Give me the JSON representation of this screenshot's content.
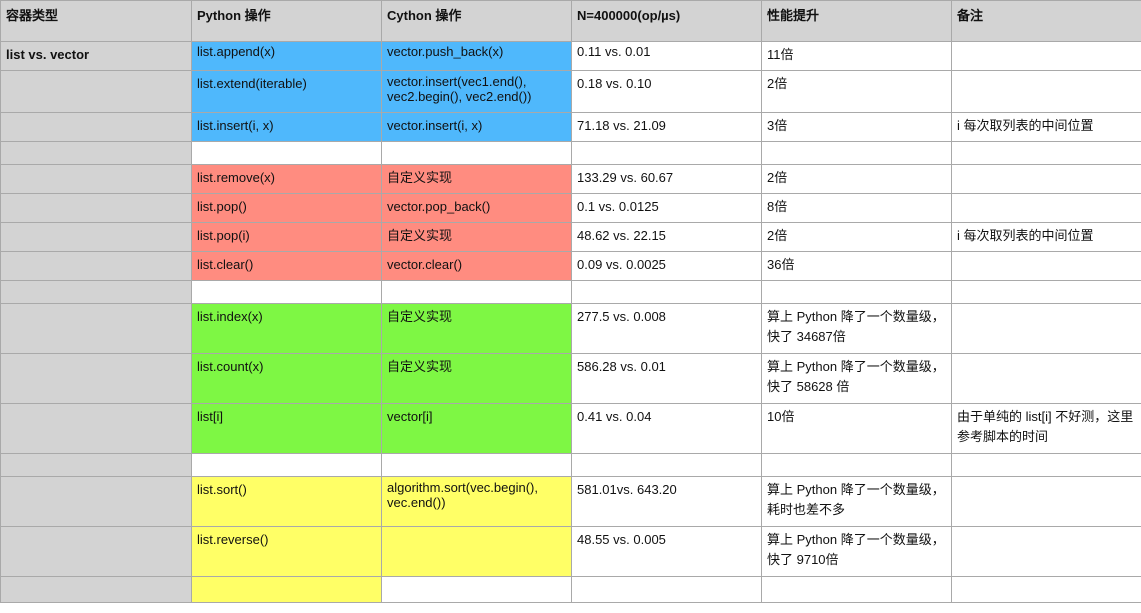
{
  "headers": [
    "容器类型",
    "Python 操作",
    "Cython 操作",
    "N=400000(op/µs)",
    "性能提升",
    "备注"
  ],
  "colors": {
    "header": "#d3d3d3",
    "blue": "#4fb8fc",
    "red": "#ff8c80",
    "green": "#7ef744",
    "yellow": "#ffff66"
  },
  "rows": [
    {
      "type": "list vs. vector",
      "py": "list.append(x)",
      "cy": "vector.push_back(x)",
      "n": "0.11 vs. 0.01",
      "perf": "11倍",
      "note": "",
      "color": "blue"
    },
    {
      "type": "",
      "py": "list.extend(iterable)",
      "cy": "vector.insert(vec1.end(), vec2.begin(), vec2.end())",
      "n": "0.18 vs. 0.10",
      "perf": "2倍",
      "note": "",
      "color": "blue"
    },
    {
      "type": "",
      "py": "list.insert(i, x)",
      "cy": "vector.insert(i, x)",
      "n": "71.18 vs. 21.09",
      "perf": "3倍",
      "note": "i 每次取列表的中间位置",
      "color": "blue"
    },
    {
      "type": "",
      "py": "",
      "cy": "",
      "n": "",
      "perf": "",
      "note": "",
      "color": ""
    },
    {
      "type": "",
      "py": "list.remove(x)",
      "cy": "自定义实现",
      "n": "133.29 vs. 60.67",
      "perf": "2倍",
      "note": "",
      "color": "red"
    },
    {
      "type": "",
      "py": "list.pop()",
      "cy": "vector.pop_back()",
      "n": "0.1 vs. 0.0125",
      "perf": "8倍",
      "note": "",
      "color": "red"
    },
    {
      "type": "",
      "py": "list.pop(i)",
      "cy": "自定义实现",
      "n": "48.62 vs. 22.15",
      "perf": "2倍",
      "note": "i 每次取列表的中间位置",
      "color": "red"
    },
    {
      "type": "",
      "py": "list.clear()",
      "cy": "vector.clear()",
      "n": "0.09 vs. 0.0025",
      "perf": "36倍",
      "note": "",
      "color": "red"
    },
    {
      "type": "",
      "py": "",
      "cy": "",
      "n": "",
      "perf": "",
      "note": "",
      "color": ""
    },
    {
      "type": "",
      "py": "list.index(x)",
      "cy": "自定义实现",
      "n": "277.5 vs. 0.008",
      "perf": "算上 Python 降了一个数量级，快了 34687倍",
      "note": "",
      "color": "green"
    },
    {
      "type": "",
      "py": "list.count(x)",
      "cy": "自定义实现",
      "n": "586.28 vs. 0.01",
      "perf": "算上 Python 降了一个数量级，快了 58628 倍",
      "note": "",
      "color": "green"
    },
    {
      "type": "",
      "py": "list[i]",
      "cy": "vector[i]",
      "n": "0.41 vs. 0.04",
      "perf": "10倍",
      "note": "由于单纯的 list[i] 不好测，这里参考脚本的时间",
      "color": "green"
    },
    {
      "type": "",
      "py": "",
      "cy": "",
      "n": "",
      "perf": "",
      "note": "",
      "color": ""
    },
    {
      "type": "",
      "py": "list.sort()",
      "cy": "algorithm.sort(vec.begin(), vec.end())",
      "n": "581.01vs. 643.20",
      "perf": "算上 Python 降了一个数量级，耗时也差不多",
      "note": "",
      "color": "yellow"
    },
    {
      "type": "",
      "py": "list.reverse()",
      "cy": "",
      "n": "48.55 vs. 0.005",
      "perf": "算上 Python 降了一个数量级，快了 9710倍",
      "note": "",
      "color": "yellow"
    },
    {
      "type": "",
      "py": "",
      "cy": "",
      "n": "",
      "perf": "",
      "note": "",
      "color": "yellow"
    }
  ]
}
